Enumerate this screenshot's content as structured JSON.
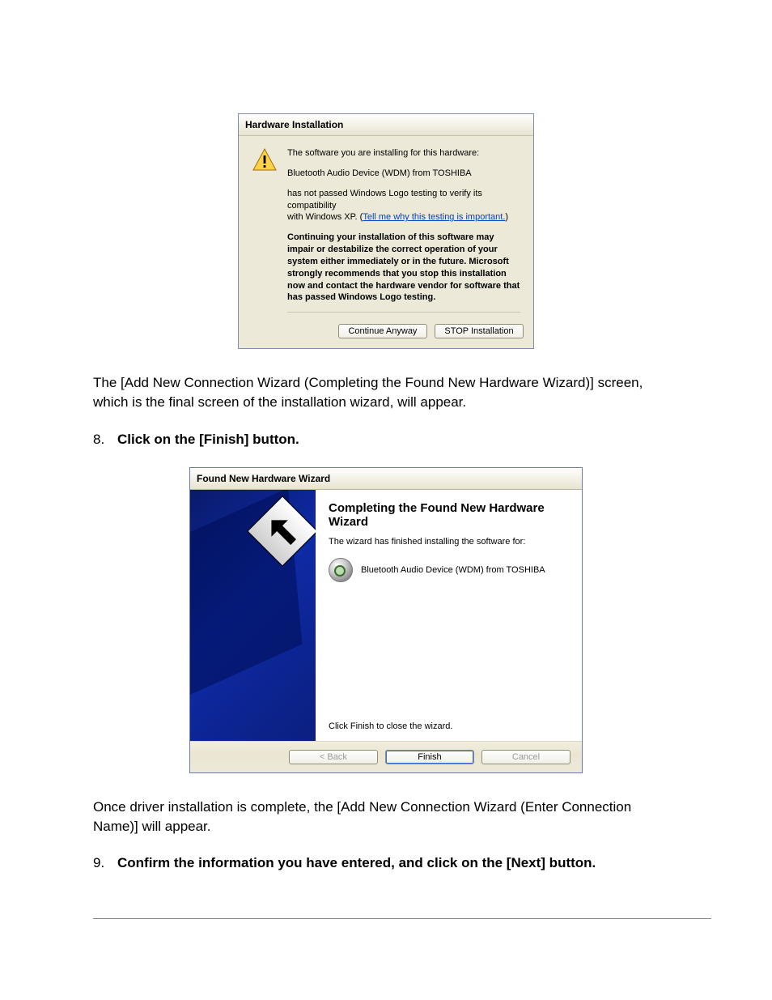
{
  "dialog1": {
    "title": "Hardware Installation",
    "line1": "The software you are installing for this hardware:",
    "device": "Bluetooth Audio Device (WDM) from TOSHIBA",
    "notpassed1": "has not passed Windows Logo testing to verify its compatibility",
    "notpassed2_prefix": "with Windows XP. (",
    "notpassed2_link": "Tell me why this testing is important.",
    "notpassed2_suffix": ")",
    "warning": "Continuing your installation of this software may impair or destabilize the correct operation of your system either immediately or in the future. Microsoft strongly recommends that you stop this installation now and contact the hardware vendor for software that has passed Windows Logo testing.",
    "continue_label": "Continue Anyway",
    "stop_label": "STOP Installation"
  },
  "para1": "The [Add New Connection Wizard (Completing the Found New Hardware Wizard)] screen, which is the final screen of the installation wizard, will appear.",
  "step8": {
    "num": "8.",
    "text": "Click on the [Finish] button."
  },
  "dialog2": {
    "title": "Found New Hardware Wizard",
    "heading": "Completing the Found New Hardware Wizard",
    "sub": "The wizard has finished installing the software for:",
    "device": "Bluetooth Audio Device (WDM) from TOSHIBA",
    "closing": "Click Finish to close the wizard.",
    "back_label": "< Back",
    "finish_label": "Finish",
    "cancel_label": "Cancel"
  },
  "para2": "Once driver installation is complete, the [Add New Connection Wizard (Enter Connection Name)] will appear.",
  "step9": {
    "num": "9.",
    "text": "Confirm the information you have entered, and click on the [Next] button."
  }
}
